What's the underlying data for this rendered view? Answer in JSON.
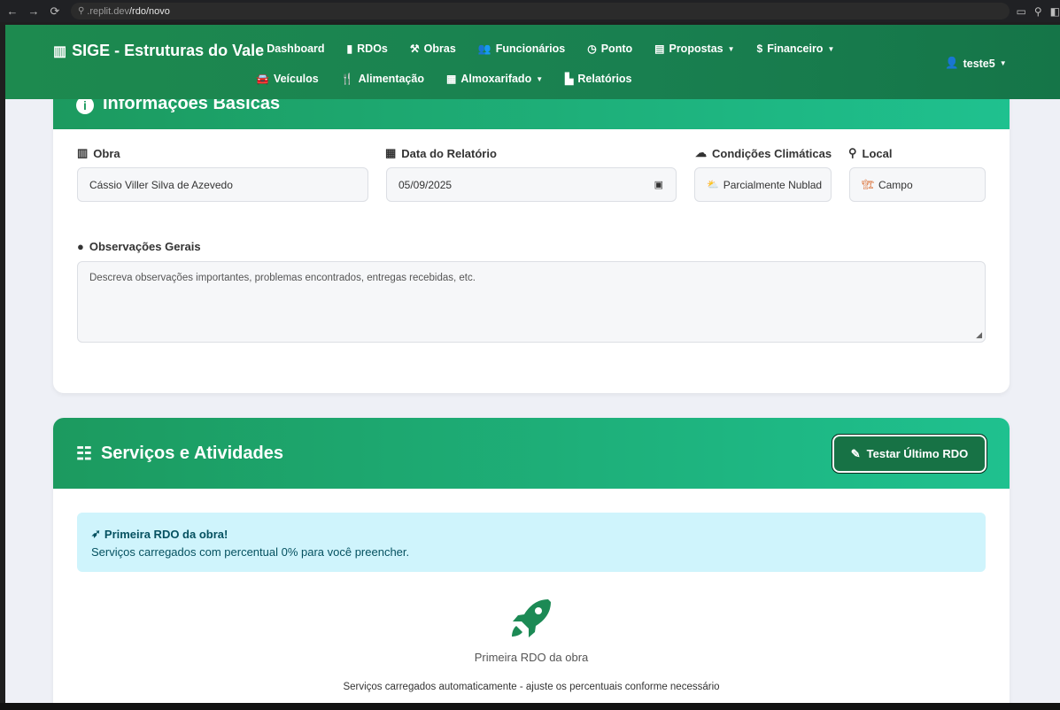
{
  "browser": {
    "url_domain": ".replit.dev",
    "url_path": "/rdo/novo",
    "back_glyph": "←",
    "forward_glyph": "→",
    "reload_glyph": "⟳"
  },
  "navbar": {
    "brand": "SIGE - Estruturas do Vale",
    "links": [
      {
        "label": "Dashboard",
        "icon": "dashboard-icon",
        "glyph": "◔"
      },
      {
        "label": "RDOs",
        "icon": "file-icon",
        "glyph": "▮"
      },
      {
        "label": "Obras",
        "icon": "hammer-icon",
        "glyph": "⚒"
      },
      {
        "label": "Funcionários",
        "icon": "users-icon",
        "glyph": "👥"
      },
      {
        "label": "Ponto",
        "icon": "clock-icon",
        "glyph": "◷"
      },
      {
        "label": "Propostas",
        "icon": "document-icon",
        "glyph": "▤"
      },
      {
        "label": "Financeiro",
        "icon": "dollar-icon",
        "glyph": "$"
      },
      {
        "label": "Veículos",
        "icon": "car-icon",
        "glyph": "🚘"
      },
      {
        "label": "Alimentação",
        "icon": "utensils-icon",
        "glyph": "🍴"
      },
      {
        "label": "Almoxarifado",
        "icon": "boxes-icon",
        "glyph": "▦"
      },
      {
        "label": "Relatórios",
        "icon": "chart-icon",
        "glyph": "▙"
      }
    ],
    "user": "teste5"
  },
  "basic_info": {
    "header": "Informações Básicas",
    "obra_label": "Obra",
    "obra_value": "Cássio Viller Silva de Azevedo",
    "data_label": "Data do Relatório",
    "data_value": "05/09/2025",
    "clima_label": "Condições Climáticas",
    "clima_value": "Parcialmente Nublad",
    "local_label": "Local",
    "local_value": "Campo",
    "obs_label": "Observações Gerais",
    "obs_placeholder": "Descreva observações importantes, problemas encontrados, entregas recebidas, etc."
  },
  "services": {
    "header": "Serviços e Atividades",
    "test_button": "Testar Último RDO",
    "alert_title": "Primeira RDO da obra!",
    "alert_text": "Serviços carregados com percentual 0% para você preencher.",
    "center_title": "Primeira RDO da obra",
    "center_sub": "Serviços carregados automaticamente - ajuste os percentuais conforme necessário"
  },
  "colors": {
    "navbar": "#198050",
    "header_start": "#1c9a5f",
    "header_end": "#1fc18f",
    "alert_bg": "#cff4fc",
    "rocket": "#1c8a55"
  }
}
